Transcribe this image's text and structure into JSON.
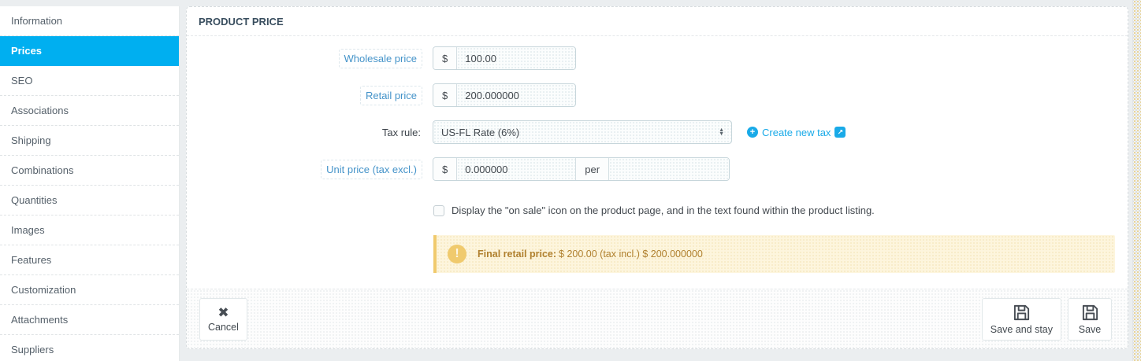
{
  "sidebar": {
    "items": [
      {
        "label": "Information",
        "active": false
      },
      {
        "label": "Prices",
        "active": true
      },
      {
        "label": "SEO",
        "active": false
      },
      {
        "label": "Associations",
        "active": false
      },
      {
        "label": "Shipping",
        "active": false
      },
      {
        "label": "Combinations",
        "active": false
      },
      {
        "label": "Quantities",
        "active": false
      },
      {
        "label": "Images",
        "active": false
      },
      {
        "label": "Features",
        "active": false
      },
      {
        "label": "Customization",
        "active": false
      },
      {
        "label": "Attachments",
        "active": false
      },
      {
        "label": "Suppliers",
        "active": false
      }
    ]
  },
  "panel": {
    "title": "PRODUCT PRICE",
    "form": {
      "wholesale": {
        "label": "Wholesale price",
        "currency": "$",
        "value": "100.00"
      },
      "retail": {
        "label": "Retail price",
        "currency": "$",
        "value": "200.000000"
      },
      "tax_rule": {
        "label": "Tax rule:",
        "selected": "US-FL Rate (6%)",
        "link_label": "Create new tax"
      },
      "unit_price": {
        "label": "Unit price (tax excl.)",
        "currency": "$",
        "value": "0.000000",
        "per_label": "per",
        "per_value": ""
      },
      "on_sale": {
        "label": "Display the \"on sale\" icon on the product page, and in the text found within the product listing.",
        "checked": false
      },
      "final_price": {
        "bold": "Final retail price:",
        "text": "$ 200.00 (tax incl.) $ 200.000000"
      }
    },
    "footer": {
      "cancel_label": "Cancel",
      "save_and_stay_label": "Save and stay",
      "save_label": "Save"
    }
  },
  "colors": {
    "accent_blue": "#00aff0",
    "link_blue": "#19aae8",
    "label_blue": "#4493c9",
    "header_text": "#384d5e",
    "warning_bg": "#fdf5dd",
    "warning_border": "#f0ca6d",
    "warning_text": "#b0802f",
    "page_bg": "#ebeef0"
  }
}
